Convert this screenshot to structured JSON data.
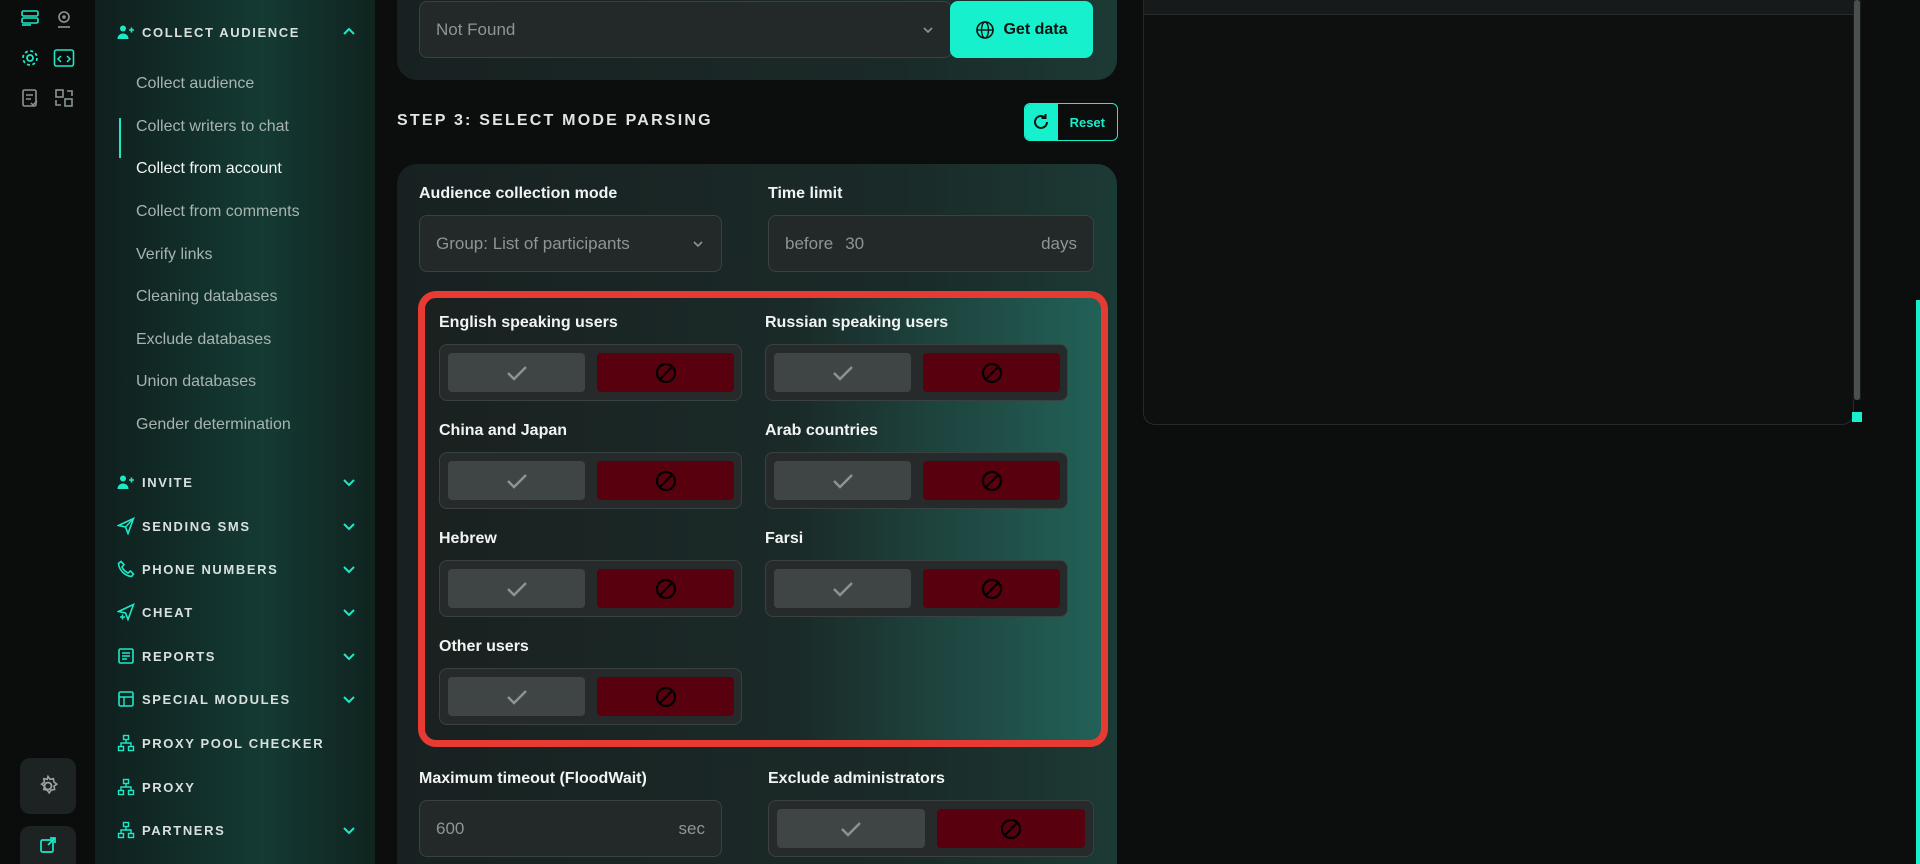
{
  "colors": {
    "accent": "#17f0cc",
    "danger": "#59000f",
    "highlight": "#e63a33"
  },
  "rail": {
    "icons": [
      "database-list-icon",
      "user-pin-icon",
      "settings-gear-icon",
      "code-window-icon",
      "checklist-icon",
      "layout-icon",
      "gear-icon",
      "external-link-icon"
    ]
  },
  "sidebar": {
    "collect": {
      "label": "COLLECT AUDIENCE",
      "items": [
        {
          "label": "Collect audience"
        },
        {
          "label": "Collect writers to chat"
        },
        {
          "label": "Collect from account"
        },
        {
          "label": "Collect from comments"
        },
        {
          "label": "Verify links"
        },
        {
          "label": "Cleaning databases"
        },
        {
          "label": "Exclude databases"
        },
        {
          "label": "Union databases"
        },
        {
          "label": "Gender determination"
        }
      ],
      "active_item": "Collect from account"
    },
    "sections": [
      {
        "label": "INVITE",
        "icon": "user-add-icon",
        "has_chevron": true
      },
      {
        "label": "SENDING SMS",
        "icon": "paper-plane-icon",
        "has_chevron": true
      },
      {
        "label": "PHONE NUMBERS",
        "icon": "phone-icon",
        "has_chevron": true
      },
      {
        "label": "CHEAT",
        "icon": "send-plus-icon",
        "has_chevron": true
      },
      {
        "label": "REPORTS",
        "icon": "report-icon",
        "has_chevron": true
      },
      {
        "label": "SPECIAL MODULES",
        "icon": "modules-icon",
        "has_chevron": true
      },
      {
        "label": "PROXY POOL CHECKER",
        "icon": "network-icon",
        "has_chevron": false
      },
      {
        "label": "PROXY",
        "icon": "network-icon",
        "has_chevron": false
      },
      {
        "label": "PARTNERS",
        "icon": "network-icon",
        "has_chevron": true
      }
    ]
  },
  "main": {
    "source_select": {
      "value": "Not Found"
    },
    "get_data_label": "Get data",
    "step3_title": "STEP 3: SELECT MODE PARSING",
    "reset_label": "Reset",
    "collection_mode": {
      "label": "Audience collection mode",
      "value": "Group: List of participants"
    },
    "time_limit": {
      "label": "Time limit",
      "prefix": "before",
      "value": "30",
      "suffix": "days"
    },
    "languages": [
      {
        "label": "English speaking users"
      },
      {
        "label": "Russian speaking users"
      },
      {
        "label": "China and Japan"
      },
      {
        "label": "Arab countries"
      },
      {
        "label": "Hebrew"
      },
      {
        "label": "Farsi"
      },
      {
        "label": "Other users"
      }
    ],
    "timeout": {
      "label": "Maximum timeout (FloodWait)",
      "value": "600",
      "suffix": "sec"
    },
    "exclude_admins": {
      "label": "Exclude administrators"
    }
  }
}
